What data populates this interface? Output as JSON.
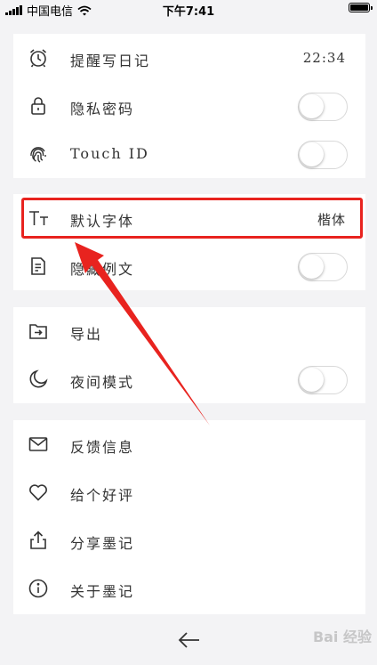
{
  "status_bar": {
    "carrier": "中国电信",
    "time": "下午7:41"
  },
  "sections": [
    {
      "rows": [
        {
          "label": "提醒写日记",
          "icon": "alarm-clock-icon",
          "value": "22:34"
        },
        {
          "label": "隐私密码",
          "icon": "lock-icon",
          "toggle": false
        },
        {
          "label": "Touch ID",
          "icon": "fingerprint-icon",
          "toggle": false
        }
      ]
    },
    {
      "rows": [
        {
          "label": "默认字体",
          "icon": "font-size-icon",
          "value": "楷体"
        },
        {
          "label": "隐藏例文",
          "icon": "document-icon",
          "toggle": false
        }
      ]
    },
    {
      "rows": [
        {
          "label": "导出",
          "icon": "export-icon"
        },
        {
          "label": "夜间模式",
          "icon": "moon-icon",
          "toggle": false
        }
      ]
    },
    {
      "rows": [
        {
          "label": "反馈信息",
          "icon": "mail-icon"
        },
        {
          "label": "给个好评",
          "icon": "heart-icon"
        },
        {
          "label": "分享墨记",
          "icon": "share-icon"
        },
        {
          "label": "关于墨记",
          "icon": "info-icon"
        }
      ]
    }
  ],
  "annotation": {
    "color": "#e8231f"
  },
  "watermark": "Bai 经验"
}
